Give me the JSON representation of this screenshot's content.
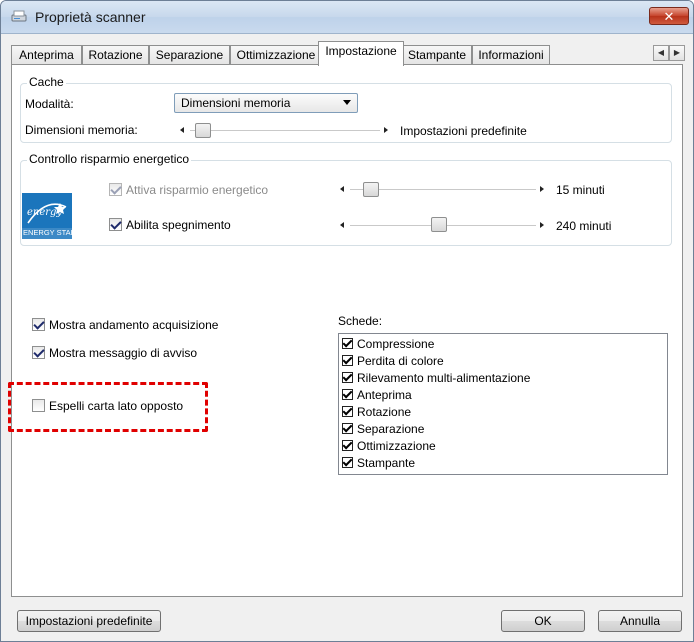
{
  "window": {
    "title": "Proprietà scanner",
    "close_glyph": "✕"
  },
  "tabs": [
    {
      "label": "Anteprima"
    },
    {
      "label": "Rotazione"
    },
    {
      "label": "Separazione"
    },
    {
      "label": "Ottimizzazione"
    },
    {
      "label": "Impostazione"
    },
    {
      "label": "Stampante"
    },
    {
      "label": "Informazioni"
    }
  ],
  "active_tab": "Impostazione",
  "cache": {
    "title": "Cache",
    "mode_label": "Modalità:",
    "mode_value": "Dimensioni memoria",
    "memory_label": "Dimensioni memoria:",
    "memory_value": "Impostazioni predefinite"
  },
  "energy": {
    "title": "Controllo risparmio energetico",
    "logo_script": "energy",
    "logo_text": "ENERGY STAR",
    "saving_label": "Attiva risparmio energetico",
    "saving_checked": true,
    "saving_value": "15 minuti",
    "shutdown_label": "Abilita spegnimento",
    "shutdown_checked": true,
    "shutdown_value": "240 minuti"
  },
  "options": {
    "show_progress": {
      "label": "Mostra andamento acquisizione",
      "checked": true
    },
    "show_warning": {
      "label": "Mostra messaggio di avviso",
      "checked": true
    },
    "eject_opposite": {
      "label": "Espelli carta lato opposto",
      "checked": false
    }
  },
  "schede": {
    "label": "Schede:",
    "items": [
      {
        "label": "Compressione",
        "checked": true
      },
      {
        "label": "Perdita di colore",
        "checked": true
      },
      {
        "label": "Rilevamento multi-alimentazione",
        "checked": true
      },
      {
        "label": "Anteprima",
        "checked": true
      },
      {
        "label": "Rotazione",
        "checked": true
      },
      {
        "label": "Separazione",
        "checked": true
      },
      {
        "label": "Ottimizzazione",
        "checked": true
      },
      {
        "label": "Stampante",
        "checked": true
      }
    ]
  },
  "buttons": {
    "defaults": "Impostazioni predefinite",
    "ok": "OK",
    "cancel": "Annulla"
  },
  "colors": {
    "highlight": "#e00000",
    "energy_star_blue": "#1b75bc"
  }
}
